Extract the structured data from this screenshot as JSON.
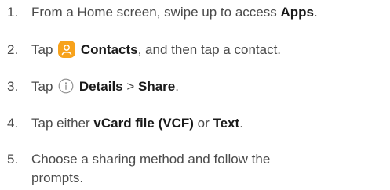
{
  "steps": [
    {
      "number": "1.",
      "text_before": "From a Home screen, swipe up to access ",
      "bold": "Apps",
      "text_after": "."
    },
    {
      "number": "2.",
      "text_before": "Tap ",
      "icon": "contacts-app-icon",
      "bold": "Contacts",
      "text_after": ", and then tap a contact."
    },
    {
      "number": "3.",
      "text_before": "Tap ",
      "icon": "info-details-icon",
      "bold": "Details",
      "separator": " > ",
      "bold2": "Share",
      "text_after": "."
    },
    {
      "number": "4.",
      "text_before": "Tap either ",
      "bold": "vCard file (VCF)",
      "middle": " or ",
      "bold2": "Text",
      "text_after": "."
    },
    {
      "number": "5.",
      "line1": "Choose a sharing method and follow the",
      "line2": "prompts."
    }
  ],
  "colors": {
    "contacts_icon_bg": "#f7a21b",
    "text": "#4a4a4a",
    "bold_text": "#1a1a1a"
  }
}
